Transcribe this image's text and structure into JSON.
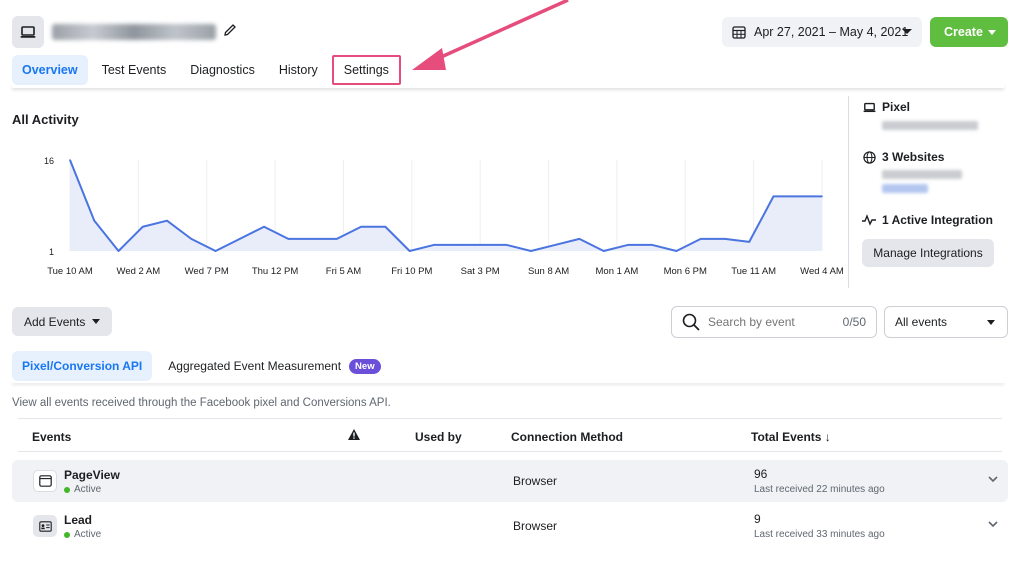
{
  "header": {
    "date_range": "Apr 27, 2021 – May 4, 2021",
    "create_label": "Create"
  },
  "tabs": [
    {
      "label": "Overview",
      "active": true
    },
    {
      "label": "Test Events",
      "active": false
    },
    {
      "label": "Diagnostics",
      "active": false
    },
    {
      "label": "History",
      "active": false
    },
    {
      "label": "Settings",
      "active": false,
      "highlighted": true
    }
  ],
  "activity": {
    "title": "All Activity"
  },
  "chart_data": {
    "type": "area",
    "title": "All Activity",
    "x_ticks": [
      "Tue 10 AM",
      "Wed 2 AM",
      "Wed 7 PM",
      "Thu 12 PM",
      "Fri 5 AM",
      "Fri 10 PM",
      "Sat 3 PM",
      "Sun 8 AM",
      "Mon 1 AM",
      "Mon 6 PM",
      "Tue 11 AM",
      "Wed 4 AM"
    ],
    "y_ticks": [
      16,
      1
    ],
    "ylim": [
      1,
      16
    ],
    "values": [
      16,
      6,
      1,
      5,
      6,
      3,
      1,
      3,
      5,
      3,
      3,
      3,
      5,
      5,
      1,
      2,
      2,
      2,
      2,
      1,
      2,
      3,
      1,
      2,
      2,
      1,
      3,
      3,
      2.5,
      10,
      10,
      10
    ],
    "line_color": "#4a74e0",
    "fill_color": "#e9edf9",
    "grid": true
  },
  "side": {
    "pixel_label": "Pixel",
    "websites_label": "3 Websites",
    "integration_label": "1 Active Integration",
    "manage_label": "Manage Integrations"
  },
  "controls": {
    "add_events_label": "Add Events",
    "search_placeholder": "Search by event",
    "search_count": "0/50",
    "filter_label": "All events"
  },
  "subtabs": [
    {
      "label": "Pixel/Conversion API",
      "active": true
    },
    {
      "label": "Aggregated Event Measurement",
      "active": false,
      "badge": "New"
    }
  ],
  "description": "View all events received through the Facebook pixel and Conversions API.",
  "table": {
    "headers": {
      "events": "Events",
      "warning_icon": "warning-icon",
      "used_by": "Used by",
      "connection": "Connection Method",
      "total": "Total Events ↓"
    },
    "rows": [
      {
        "name": "PageView",
        "status": "Active",
        "method": "Browser",
        "total": "96",
        "last": "Last received 22 minutes ago",
        "icon": "page-icon"
      },
      {
        "name": "Lead",
        "status": "Active",
        "method": "Browser",
        "total": "9",
        "last": "Last received 33 minutes ago",
        "icon": "id-card-icon"
      }
    ]
  }
}
